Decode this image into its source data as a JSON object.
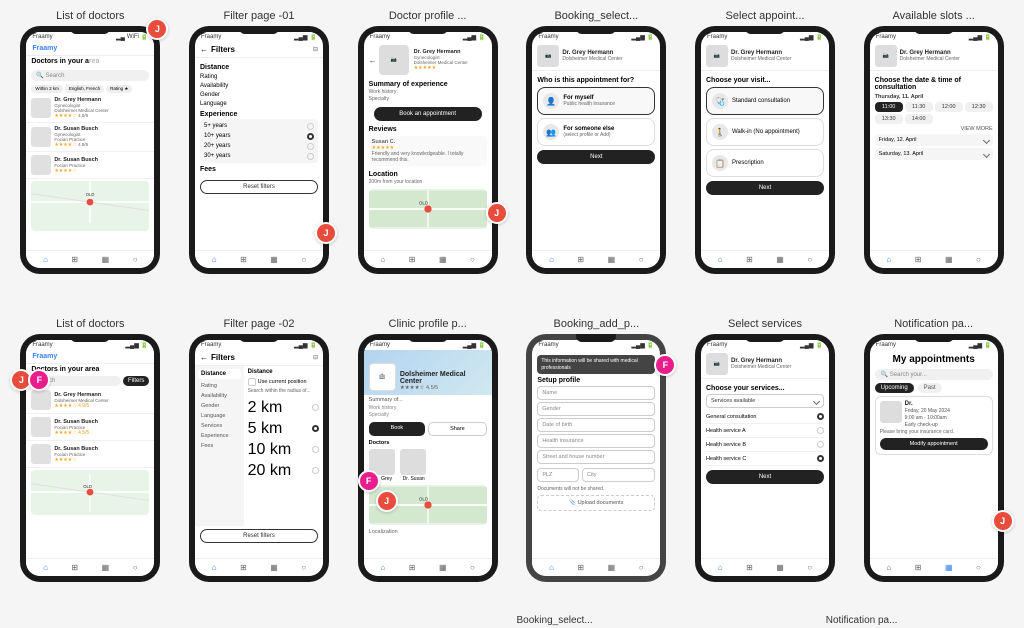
{
  "grid": {
    "rows": [
      [
        {
          "label": "List of doctors",
          "type": "list_doctors"
        },
        {
          "label": "Filter page -01",
          "type": "filter_01"
        },
        {
          "label": "Doctor profile ...",
          "type": "doctor_profile"
        },
        {
          "label": "Booking_select...",
          "type": "booking_select"
        },
        {
          "label": "Select appoint...",
          "type": "select_appointment"
        },
        {
          "label": "Available slots ...",
          "type": "available_slots"
        }
      ],
      [
        {
          "label": "List of doctors",
          "type": "list_doctors_2"
        },
        {
          "label": "Filter page -02",
          "type": "filter_02"
        },
        {
          "label": "Clinic profile p...",
          "type": "clinic_profile"
        },
        {
          "label": "Booking_add_p...",
          "type": "booking_add"
        },
        {
          "label": "Select services",
          "type": "select_services"
        },
        {
          "label": "Notification pa...",
          "type": "notification"
        }
      ]
    ],
    "bottom_labels": [
      "Booking_select...",
      "Notification pa..."
    ]
  },
  "doctor": {
    "name": "Dr. Grey Hermann",
    "role": "Gynecologist",
    "clinic": "Dolsheimer Medical Center",
    "rating": "4.9/5",
    "stars": "★★★★★"
  },
  "filter01": {
    "title": "Filters",
    "sections": [
      "Distance",
      "Rating",
      "Availability",
      "Gender",
      "Language",
      "Experience",
      "Fees"
    ],
    "options": [
      "5+ years",
      "10+ years",
      "20+ years",
      "30+ years"
    ]
  },
  "filter02": {
    "title": "Filters",
    "active_section": "Distance",
    "options": [
      "Use current position",
      "Search within the radius of...",
      "2 km",
      "5 km",
      "10 km",
      "20 km"
    ],
    "sections": [
      "Rating",
      "Availability",
      "Gender",
      "Language",
      "Services",
      "Experience",
      "Fees"
    ]
  },
  "booking": {
    "question": "Who is this appointment for?",
    "option1": "For myself",
    "option1_sub": "Public health insurance",
    "option2": "For someone else",
    "option2_sub": "(select profile or Add)",
    "next_label": "Next"
  },
  "appointment": {
    "title": "Choose your visit...",
    "options": [
      "Standard consultation",
      "Walk-in (No appointment)",
      "Prescription"
    ],
    "next_label": "Next"
  },
  "slots": {
    "title": "Choose the date & time of consultation",
    "day1": "Thursday, 11. April",
    "times1": [
      "11:00",
      "11:30",
      "12:00",
      "12:30",
      "13:30",
      "14:00"
    ],
    "view_more": "VIEW MORE",
    "day2": "Friday, 12. April",
    "day3": "Saturday, 13. April"
  },
  "booking_add": {
    "banner": "This information will be shared with medical professionals",
    "title": "Setup profile",
    "fields": [
      "Name",
      "Gender",
      "Date of birth",
      "Health insurance",
      "Street and house number",
      "PLZ",
      "City"
    ],
    "note": "Documents will not be shared.",
    "upload": "Upload documents"
  },
  "services": {
    "title": "Choose your services...",
    "dropdown": "Services available",
    "options": [
      "General consultation",
      "Health service A",
      "Health service B",
      "Health service C"
    ],
    "next_label": "Next"
  },
  "notification": {
    "title": "My appointments",
    "search_placeholder": "Search your...",
    "tabs": [
      "Upcoming",
      "Past"
    ],
    "appointment": {
      "doctor": "Dr.",
      "date": "Friday, 20 May 2024",
      "time": "9:00 am - 10:00am",
      "type": "Early check-up",
      "note": "Please bring your insurance card.",
      "action": "Modify appointment"
    }
  },
  "icons": {
    "home": "⌂",
    "grid": "⊞",
    "calendar": "📅",
    "person": "👤",
    "search": "🔍",
    "back": "←",
    "location": "📍",
    "filter": "⊟"
  },
  "colors": {
    "brand_blue": "#3b82f6",
    "dark": "#222222",
    "badge_red": "#e74c3c",
    "badge_pink": "#e91e8c"
  }
}
